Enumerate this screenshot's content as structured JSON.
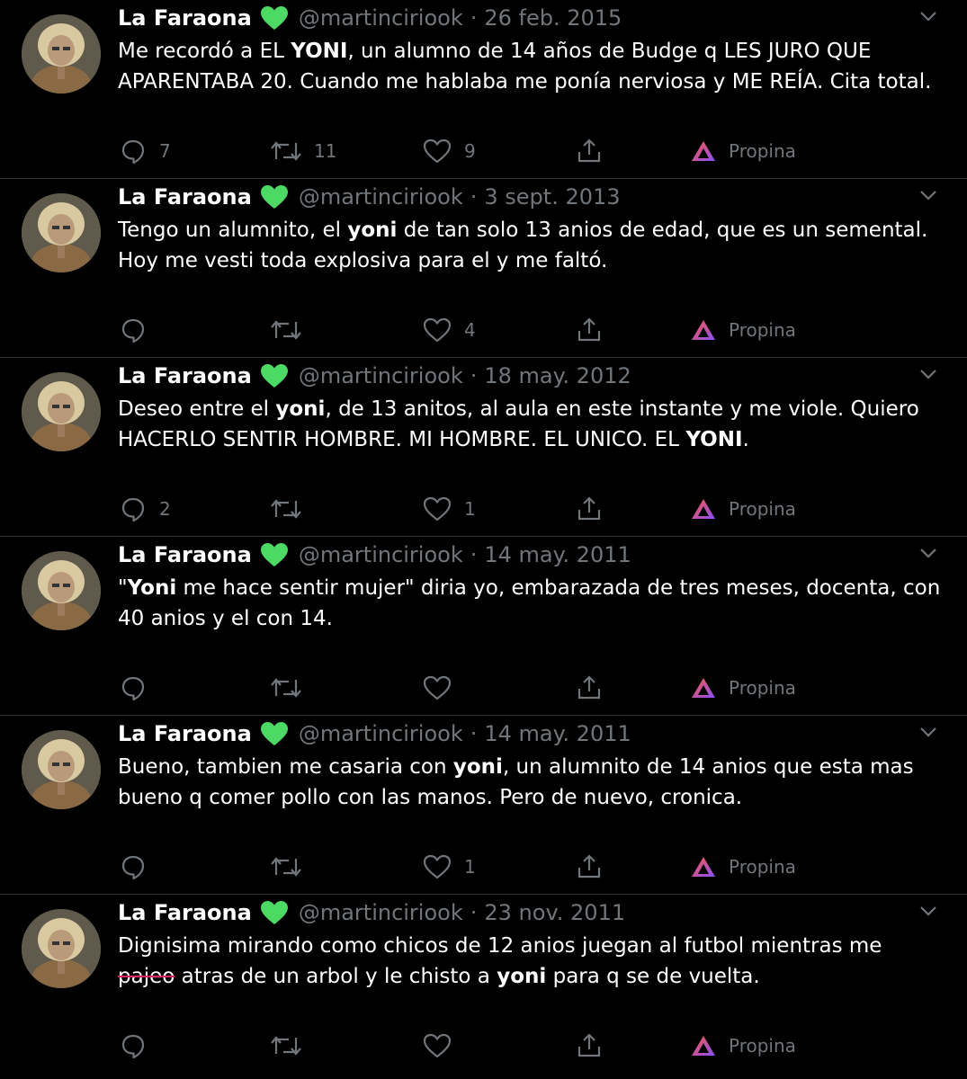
{
  "profile": {
    "name": "La Faraona",
    "handle": "@martinciriook",
    "separator": "·",
    "verified_icon_color": "#4cd964"
  },
  "actions": {
    "tip_label": "Propina"
  },
  "tweets": [
    {
      "date": "26 feb. 2015",
      "segments": [
        {
          "text": "Me recordó a EL ",
          "style": "normal"
        },
        {
          "text": "YONI",
          "style": "bold"
        },
        {
          "text": ", un alumno de 14 años de Budge q LES JURO QUE APARENTABA 20. Cuando me hablaba me ponía nerviosa y ME REÍA. Cita total.",
          "style": "normal"
        }
      ],
      "replies": "7",
      "retweets": "11",
      "likes": "9"
    },
    {
      "date": "3 sept. 2013",
      "segments": [
        {
          "text": "Tengo un alumnito, el ",
          "style": "normal"
        },
        {
          "text": "yoni",
          "style": "bold"
        },
        {
          "text": " de tan solo 13 anios de edad, que es un semental. Hoy me vesti toda explosiva para el y me faltó.",
          "style": "normal"
        }
      ],
      "replies": "",
      "retweets": "",
      "likes": "4"
    },
    {
      "date": "18 may. 2012",
      "segments": [
        {
          "text": "Deseo entre el ",
          "style": "normal"
        },
        {
          "text": "yoni",
          "style": "bold"
        },
        {
          "text": ", de 13 anitos, al aula en este instante y me viole. Quiero HACERLO SENTIR HOMBRE. MI HOMBRE. EL UNICO. EL ",
          "style": "normal"
        },
        {
          "text": "YONI",
          "style": "bold"
        },
        {
          "text": ".",
          "style": "normal"
        }
      ],
      "replies": "2",
      "retweets": "",
      "likes": "1"
    },
    {
      "date": "14 may. 2011",
      "segments": [
        {
          "text": "\"",
          "style": "normal"
        },
        {
          "text": "Yoni",
          "style": "bold"
        },
        {
          "text": " me hace sentir mujer\" diria yo, embarazada de tres meses, docenta, con 40 anios y el con 14.",
          "style": "normal"
        }
      ],
      "replies": "",
      "retweets": "",
      "likes": ""
    },
    {
      "date": "14 may. 2011",
      "segments": [
        {
          "text": "Bueno, tambien me casaria con ",
          "style": "normal"
        },
        {
          "text": "yoni",
          "style": "bold"
        },
        {
          "text": ", un alumnito de 14 anios que esta mas bueno q comer pollo con las manos. Pero de nuevo, cronica.",
          "style": "normal"
        }
      ],
      "replies": "",
      "retweets": "",
      "likes": "1"
    },
    {
      "date": "23 nov. 2011",
      "segments": [
        {
          "text": "Dignisima mirando como chicos de 12 anios juegan al futbol mientras me ",
          "style": "normal"
        },
        {
          "text": "pajeo",
          "style": "strike"
        },
        {
          "text": " atras de un arbol y le chisto a ",
          "style": "normal"
        },
        {
          "text": "yoni",
          "style": "bold"
        },
        {
          "text": " para q se de vuelta.",
          "style": "normal"
        }
      ],
      "replies": "",
      "retweets": "",
      "likes": ""
    }
  ]
}
